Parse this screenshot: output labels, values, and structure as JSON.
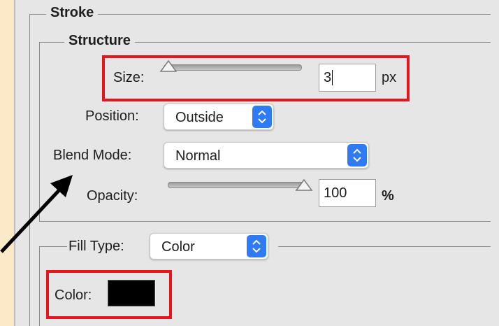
{
  "stroke": {
    "title": "Stroke",
    "structure": {
      "title": "Structure",
      "size": {
        "label": "Size:",
        "value": "3",
        "unit": "px",
        "slider_level": 0.01
      },
      "position": {
        "label": "Position:",
        "selected": "Outside"
      },
      "blend_mode": {
        "label": "Blend Mode:",
        "selected": "Normal"
      },
      "opacity": {
        "label": "Opacity:",
        "value": "100",
        "unit": "%",
        "slider_level": 1.0
      }
    },
    "fill_type": {
      "label": "Fill Type:",
      "selected": "Color"
    },
    "color": {
      "label": "Color:",
      "swatch": "#000000"
    }
  },
  "highlight_color": "#e8141d",
  "popup_accent": "#2f7bf5"
}
